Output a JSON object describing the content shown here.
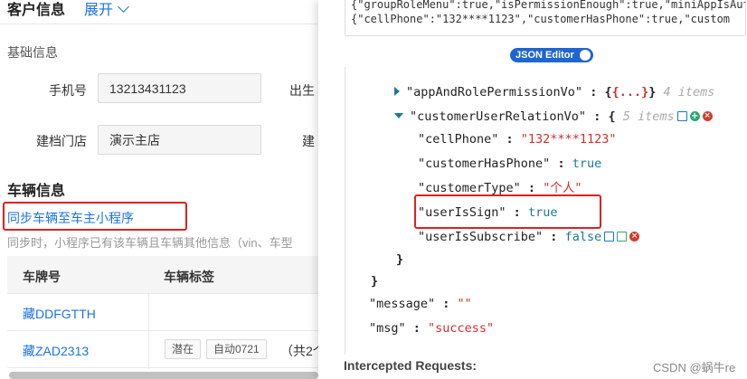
{
  "customer_section": {
    "title": "客户信息",
    "expand_label": "展开"
  },
  "basic_info": {
    "subtitle": "基础信息",
    "phone_label": "手机号",
    "phone_value": "13213431123",
    "birthday_label": "出生",
    "store_label": "建档门店",
    "store_value": "演示主店",
    "store_right_label": "建"
  },
  "vehicle_section": {
    "title": "车辆信息",
    "sync_link": "同步车辆至车主小程序",
    "hint": "同步时，小程序已有该车辆且车辆其他信息（vin、车型",
    "columns": [
      "车牌号",
      "车辆标签"
    ],
    "rows": [
      {
        "plate": "藏DDFGTTH",
        "tags": [],
        "count": ""
      },
      {
        "plate": "藏ZAD2313",
        "tags": [
          "潜在",
          "自动0721"
        ],
        "count": "（共2个"
      }
    ]
  },
  "json_viewer": {
    "raw_lines": [
      "{\"groupRoleMenu\":true,\"isPermissionEnough\":true,\"miniAppIsAuth\":true,\"officialAccountIsAuth\":true},\"customerUserRelationVo\":",
      "{\"cellPhone\":\"132****1123\",\"customerHasPhone\":true,\"custom"
    ],
    "editor_button": "JSON Editor",
    "tree": {
      "collapsed_key": "\"appAndRolePermissionVo\"",
      "collapsed_preview": "{...}",
      "collapsed_meta": "4 items",
      "expanded_key": "\"customerUserRelationVo\"",
      "expanded_meta": "5 items",
      "fields": [
        {
          "key": "\"cellPhone\"",
          "value": "\"132****1123\"",
          "type": "string"
        },
        {
          "key": "\"customerHasPhone\"",
          "value": "true",
          "type": "bool"
        },
        {
          "key": "\"customerType\"",
          "value": "\"个人\"",
          "type": "string"
        },
        {
          "key": "\"userIsSign\"",
          "value": "true",
          "type": "bool"
        },
        {
          "key": "\"userIsSubscribe\"",
          "value": "false",
          "type": "bool"
        }
      ],
      "message_key": "\"message\"",
      "message_value": "\"\"",
      "msg_key": "\"msg\"",
      "msg_value": "\"success\""
    },
    "footer": "Intercepted Requests:"
  },
  "watermark": "CSDN @蜗牛re",
  "colors": {
    "link": "#1a73e8",
    "highlight_box": "#e02020",
    "json_string": "#d42f2f",
    "json_bool": "#1a7a9a",
    "editor_button": "#1e66d0"
  },
  "icons": [
    "chevron-down-icon",
    "expand-arrow-icon",
    "collapse-arrow-icon",
    "copy-icon",
    "add-icon",
    "delete-icon",
    "edit-icon",
    "toggle-icon"
  ]
}
